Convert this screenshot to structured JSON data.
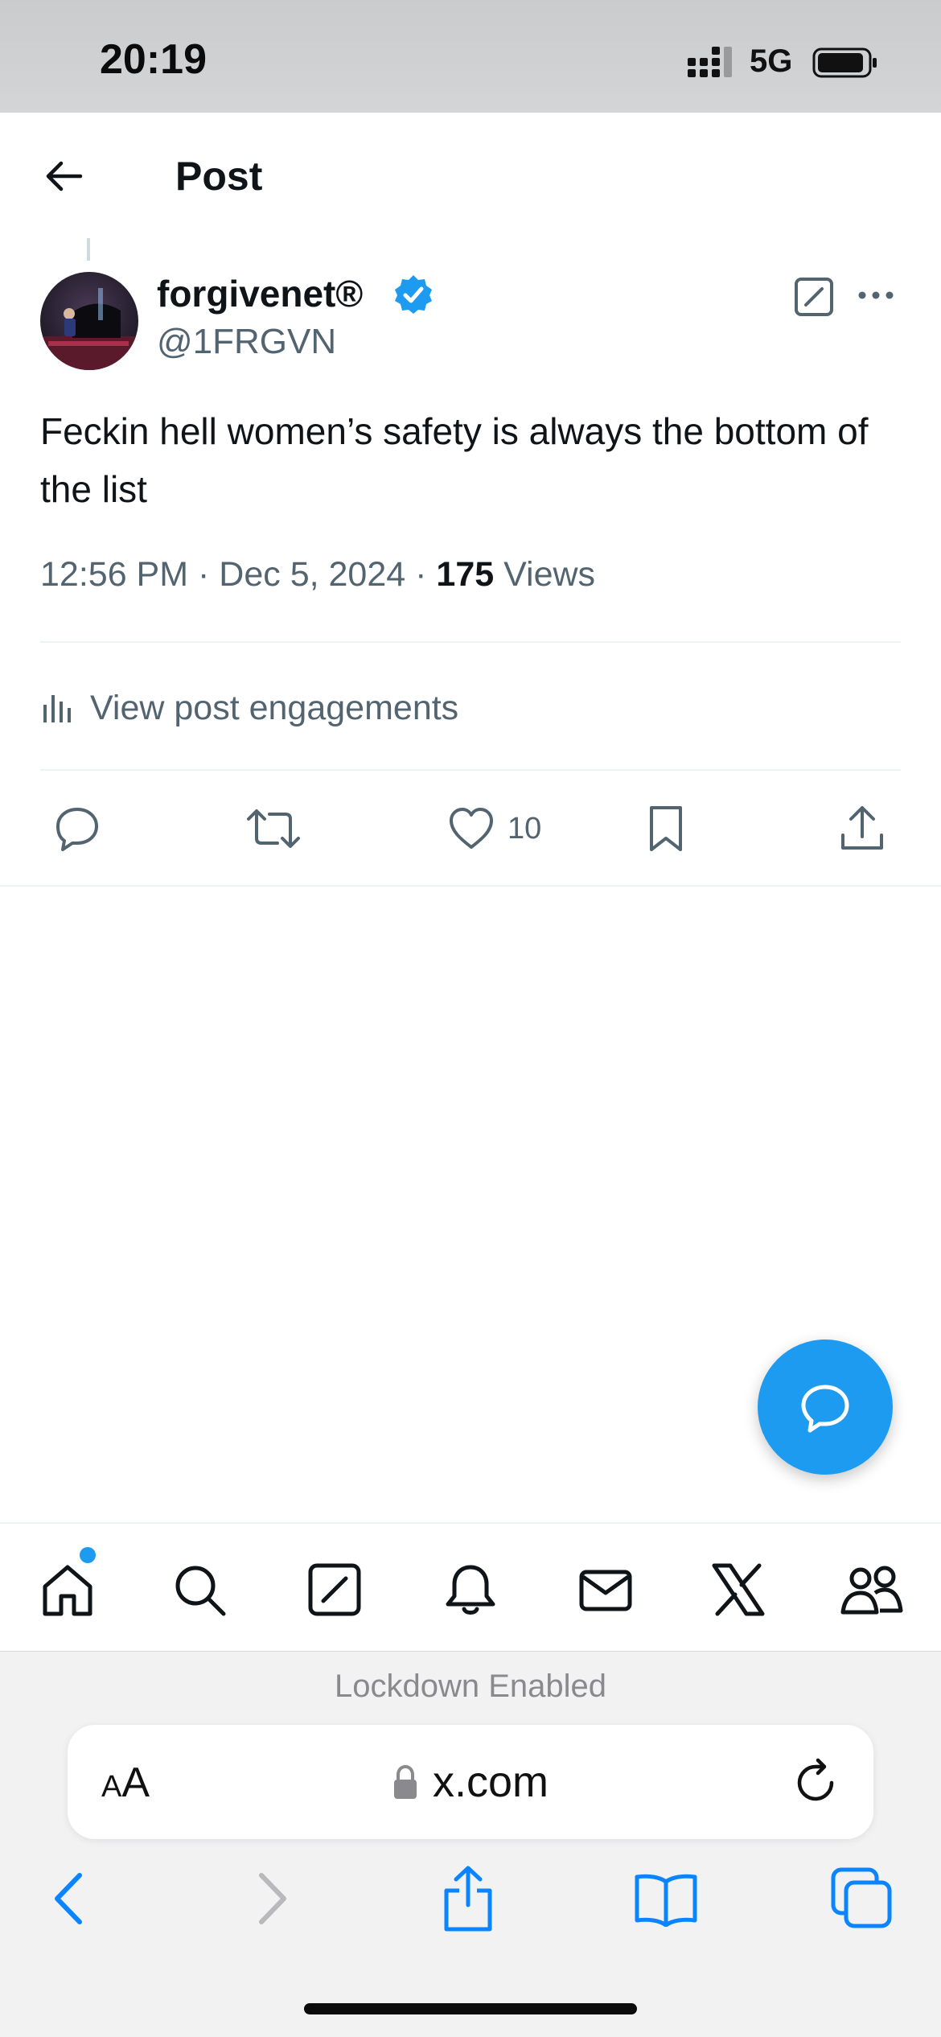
{
  "status_bar": {
    "time": "20:19",
    "network": "5G"
  },
  "header": {
    "title": "Post"
  },
  "post": {
    "display_name": "forgivenet®",
    "handle": "@1FRGVN",
    "text": "Feckin hell women’s safety is always the bottom of the list",
    "time": "12:56 PM",
    "date": "Dec 5, 2024",
    "views_count": "175",
    "views_label": "Views",
    "engagements_label": "View post engagements",
    "likes": "10"
  },
  "safari": {
    "lockdown": "Lockdown Enabled",
    "text_size_label": "AA",
    "url": "x.com"
  },
  "colors": {
    "accent": "#1d9bf0",
    "secondary_text": "#536471",
    "safari_blue": "#0a84ff"
  }
}
